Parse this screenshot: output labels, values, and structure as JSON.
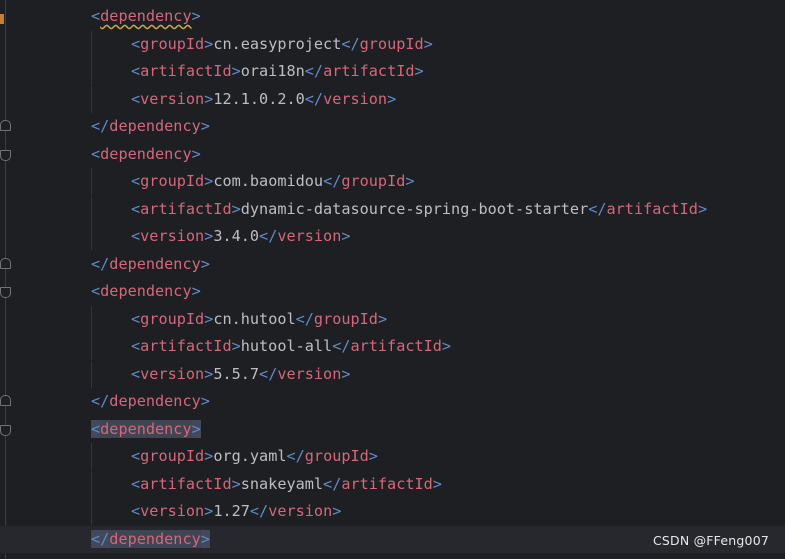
{
  "editor": {
    "lines": [
      {
        "indent": 1,
        "kind": "open",
        "tag": "dependency",
        "warn": true
      },
      {
        "indent": 2,
        "kind": "elem",
        "tag": "groupId",
        "value": "cn.easyproject"
      },
      {
        "indent": 2,
        "kind": "elem",
        "tag": "artifactId",
        "value": "orai18n"
      },
      {
        "indent": 2,
        "kind": "elem",
        "tag": "version",
        "value": "12.1.0.2.0"
      },
      {
        "indent": 1,
        "kind": "close",
        "tag": "dependency"
      },
      {
        "indent": 1,
        "kind": "open",
        "tag": "dependency"
      },
      {
        "indent": 2,
        "kind": "elem",
        "tag": "groupId",
        "value": "com.baomidou"
      },
      {
        "indent": 2,
        "kind": "elem",
        "tag": "artifactId",
        "value": "dynamic-datasource-spring-boot-starter"
      },
      {
        "indent": 2,
        "kind": "elem",
        "tag": "version",
        "value": "3.4.0"
      },
      {
        "indent": 1,
        "kind": "close",
        "tag": "dependency"
      },
      {
        "indent": 1,
        "kind": "open",
        "tag": "dependency"
      },
      {
        "indent": 2,
        "kind": "elem",
        "tag": "groupId",
        "value": "cn.hutool"
      },
      {
        "indent": 2,
        "kind": "elem",
        "tag": "artifactId",
        "value": "hutool-all"
      },
      {
        "indent": 2,
        "kind": "elem",
        "tag": "version",
        "value": "5.5.7"
      },
      {
        "indent": 1,
        "kind": "close",
        "tag": "dependency"
      },
      {
        "indent": 1,
        "kind": "open",
        "tag": "dependency",
        "highlight": true
      },
      {
        "indent": 2,
        "kind": "elem",
        "tag": "groupId",
        "value": "org.yaml"
      },
      {
        "indent": 2,
        "kind": "elem",
        "tag": "artifactId",
        "value": "snakeyaml"
      },
      {
        "indent": 2,
        "kind": "elem",
        "tag": "version",
        "value": "1.27"
      },
      {
        "indent": 1,
        "kind": "close",
        "tag": "dependency",
        "highlight": true,
        "current": true
      }
    ]
  },
  "icons": {
    "fold_marker": "fold-icon",
    "intention": "lightbulb-icon"
  },
  "colors": {
    "background": "#1e1f22",
    "bracket": "#5f8bc9",
    "tag": "#d5677b",
    "text": "#bcbec4",
    "bulb": "#f2c55c"
  },
  "watermark": "CSDN @FFeng007"
}
